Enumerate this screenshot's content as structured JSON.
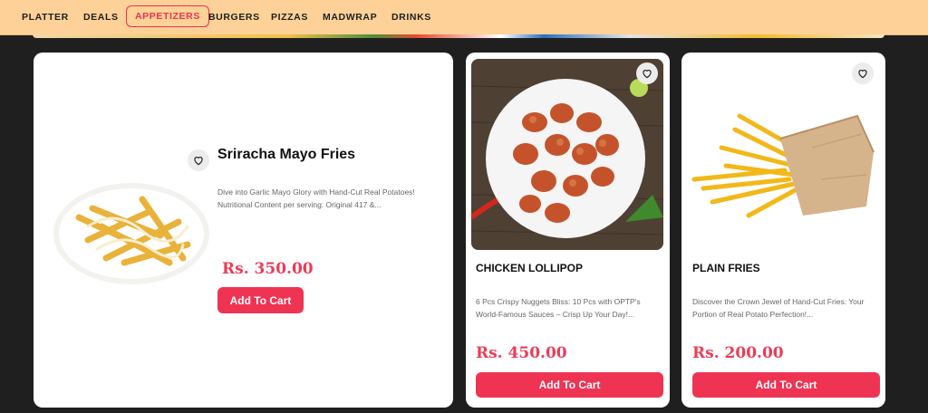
{
  "nav": {
    "items": [
      {
        "label": "PLATTER"
      },
      {
        "label": "DEALS"
      },
      {
        "label": "APPETIZERS",
        "active": true
      },
      {
        "label": "BURGERS"
      },
      {
        "label": "PIZZAS"
      },
      {
        "label": "MADWRAP"
      },
      {
        "label": "DRINKS"
      }
    ]
  },
  "products": [
    {
      "title": "Sriracha Mayo Fries",
      "description": "Dive into Garlic Mayo Glory with Hand-Cut Real Potatoes! Nutritional Content per serving: Original 417 &...",
      "price": "Rs. 350.00",
      "button": "Add To Cart",
      "image": "sriracha-mayo-fries"
    },
    {
      "title": "CHICKEN LOLLIPOP",
      "description": "6 Pcs Crispy Nuggets Bliss: 10 Pcs with OPTP's World-Famous Sauces – Crisp Up Your Day!...",
      "price": "Rs. 450.00",
      "button": "Add To Cart",
      "image": "chicken-lollipop"
    },
    {
      "title": "PLAIN FRIES",
      "description": "Discover the Crown Jewel of Hand-Cut Fries: Your Portion of Real Potato Perfection!...",
      "price": "Rs. 200.00",
      "button": "Add To Cart",
      "image": "plain-fries"
    }
  ],
  "colors": {
    "nav_bg": "#fdd197",
    "accent": "#ef3453",
    "page_bg": "#201f1f"
  }
}
